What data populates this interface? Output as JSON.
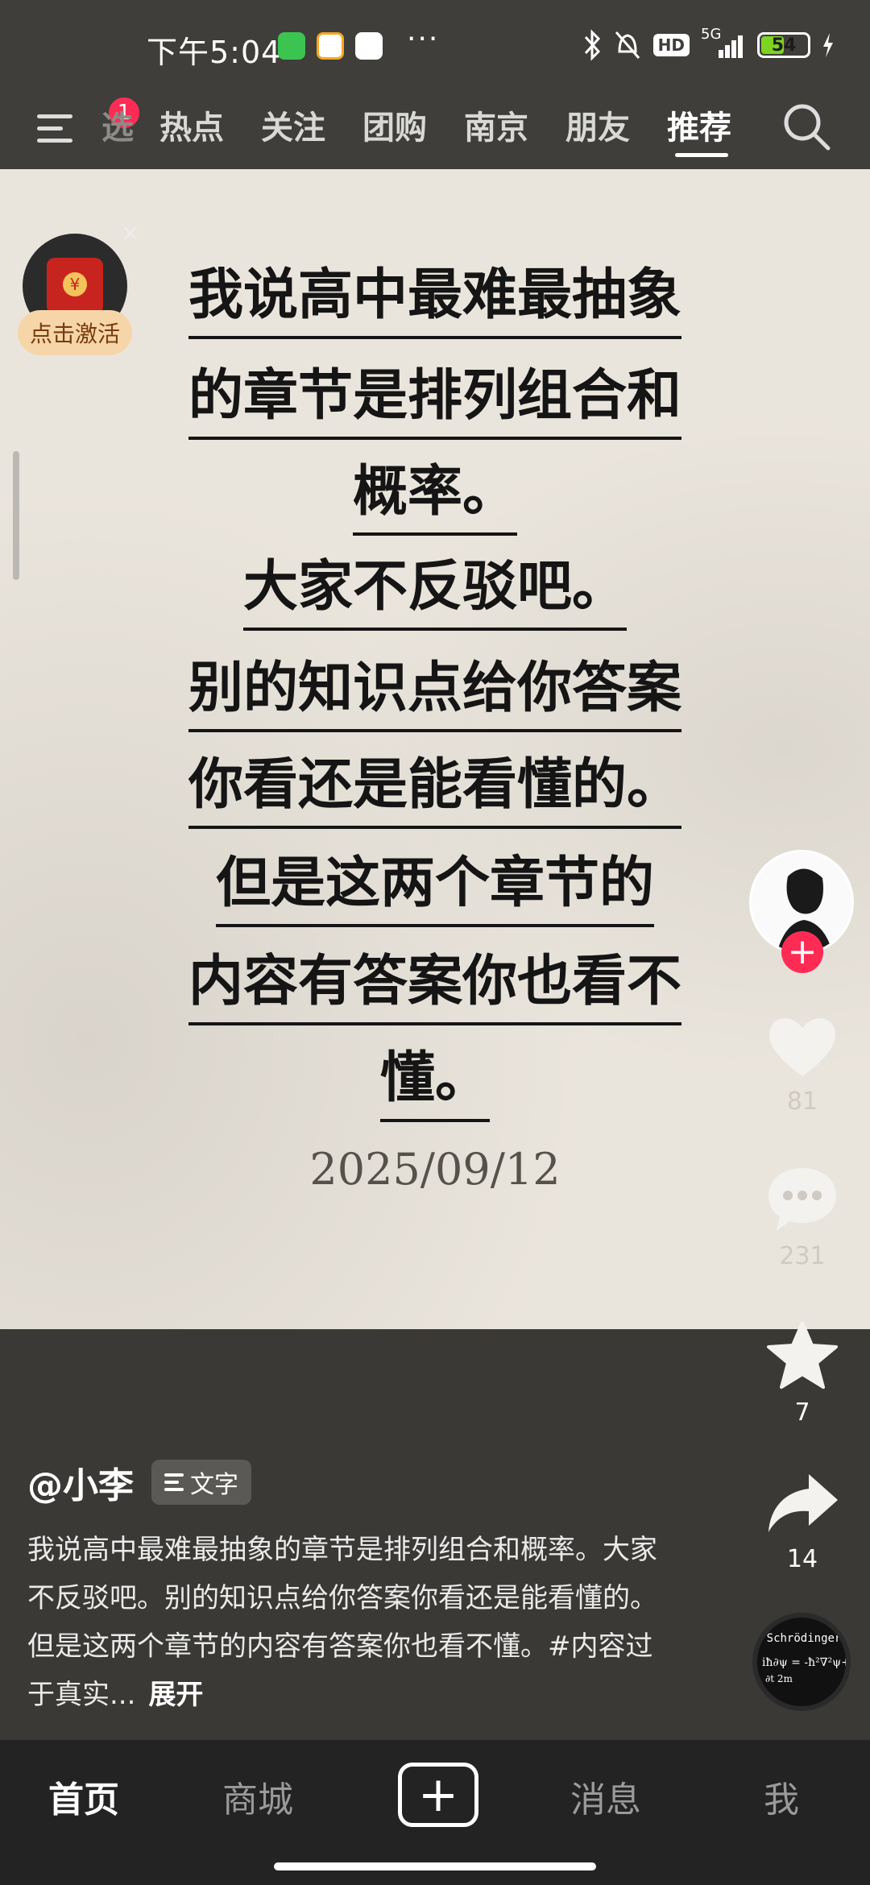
{
  "status_bar": {
    "time": "下午5:04",
    "more": "···",
    "network": "5G",
    "hd": "HD",
    "battery_level": 54,
    "battery_text": "54",
    "icons": [
      "wechat-icon",
      "58-app-icon",
      "cloud-app-icon",
      "bluetooth-icon",
      "mute-icon",
      "signal-icon",
      "battery-icon",
      "charging-icon"
    ]
  },
  "top_nav": {
    "menu_badge": "1",
    "tabs": [
      "热点",
      "关注",
      "团购",
      "南京",
      "朋友",
      "推荐"
    ],
    "active_tab": "推荐",
    "partial_tab": "选"
  },
  "post": {
    "lines": [
      "我说高中最难最抽象",
      "的章节是排列组合和",
      "概率。",
      "大家不反驳吧。",
      "别的知识点给你答案",
      "你看还是能看懂的。",
      "但是这两个章节的",
      "内容有答案你也看不",
      "懂。"
    ],
    "date": "2025/09/12"
  },
  "redpacket": {
    "label": "点击激活",
    "close": "×",
    "coin": "¥"
  },
  "actions": {
    "likes": "81",
    "comments": "231",
    "favorites": "7",
    "shares": "14"
  },
  "follow": "+",
  "music_disc": {
    "title": "Schrödinger"
  },
  "caption": {
    "author": "@小李",
    "type_chip": "文字",
    "text": "我说高中最难最抽象的章节是排列组合和概率。大家不反驳吧。别的知识点给你答案你看还是能看懂的。但是这两个章节的内容有答案你也看不懂。#内容过于真实...",
    "expand": "展开"
  },
  "bottom_tabs": {
    "home": "首页",
    "mall": "商城",
    "add": "+",
    "messages": "消息",
    "me": "我",
    "active": "首页"
  },
  "colors": {
    "accent_red": "#fe2c55",
    "post_bg": "#eae5dc",
    "bar_bg": "#3f3e3b",
    "tabbar_bg": "#232323"
  }
}
